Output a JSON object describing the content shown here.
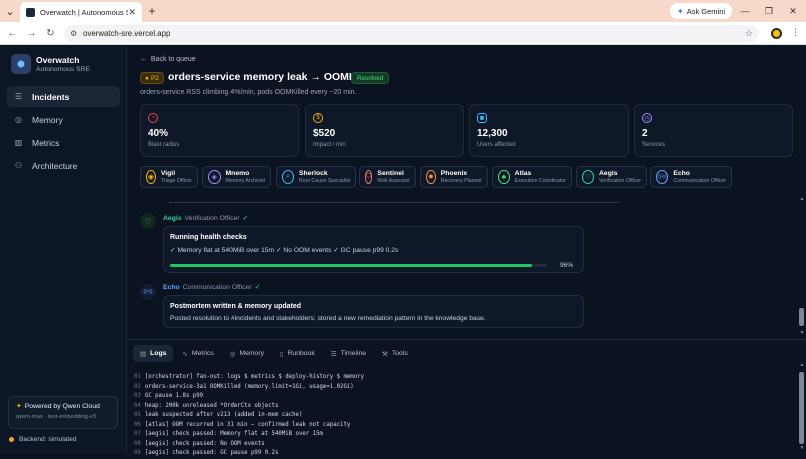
{
  "browser": {
    "tab_title": "Overwatch | Autonomous SRE",
    "tab_close": "✕",
    "new_tab": "+",
    "gemini_label": "Ask Gemini",
    "url": "overwatch-sre.vercel.app",
    "window_controls": [
      "—",
      "❐",
      "✕"
    ]
  },
  "sidebar": {
    "brand_name": "Overwatch",
    "brand_sub": "Autonomous SRE",
    "items": [
      {
        "label": "Incidents",
        "icon": "list-icon"
      },
      {
        "label": "Memory",
        "icon": "memory-icon"
      },
      {
        "label": "Metrics",
        "icon": "bar-chart-icon"
      },
      {
        "label": "Architecture",
        "icon": "tree-icon"
      }
    ],
    "powered_title": "Powered by Qwen Cloud",
    "powered_sub": "qwen-max · text-embedding-v3",
    "backend": "Backend: simulated"
  },
  "incident": {
    "back": "Back to queue",
    "priority": "P2",
    "title": "orders-service memory leak → OOMKilled",
    "status": "Resolved",
    "subtitle": "orders-service RSS climbing 4%/min, pods OOMKilled every ~20 min."
  },
  "stats": [
    {
      "value": "40%",
      "label": "Blast radius",
      "color": "#ef4444"
    },
    {
      "value": "$520",
      "label": "Impact / min",
      "color": "#f5b400"
    },
    {
      "value": "12,300",
      "label": "Users affected",
      "color": "#38bdf8"
    },
    {
      "value": "2",
      "label": "Services",
      "color": "#a78bfa"
    }
  ],
  "agents": [
    {
      "name": "Vigil",
      "role": "Triage Officer",
      "color": "#f5b400",
      "glyph": "◉"
    },
    {
      "name": "Mnemo",
      "role": "Memory Archivist",
      "color": "#a78bfa",
      "glyph": "◈"
    },
    {
      "name": "Sherlock",
      "role": "Root Cause Specialist",
      "color": "#38bdf8",
      "glyph": "⌕"
    },
    {
      "name": "Sentinel",
      "role": "Risk Assessor",
      "color": "#f87171",
      "glyph": "⛉"
    },
    {
      "name": "Phoenix",
      "role": "Recovery Planner",
      "color": "#fb923c",
      "glyph": "✹"
    },
    {
      "name": "Atlas",
      "role": "Execution Coordinator",
      "color": "#4ade80",
      "glyph": "♣"
    },
    {
      "name": "Aegis",
      "role": "Verification Officer",
      "color": "#34d399",
      "glyph": "♡"
    },
    {
      "name": "Echo",
      "role": "Communication Officer",
      "color": "#60a5fa",
      "glyph": "((•))"
    }
  ],
  "timeline": {
    "aegis": {
      "agent": "Aegis",
      "role": "Verification Officer",
      "card_title": "Running health checks",
      "card_body": "✓ Memory flat at 540MiB over 15m ✓ No OOM events ✓ GC pause p99 0.2s",
      "progress": 96,
      "progress_label": "96%"
    },
    "echo": {
      "agent": "Echo",
      "role": "Communication Officer",
      "card_title": "Postmortem written & memory updated",
      "card_body": "Posted resolution to #incidents and stakeholders; stored a new remediation pattern in the knowledge base."
    }
  },
  "console": {
    "tabs": [
      {
        "label": "Logs",
        "icon": "file-icon"
      },
      {
        "label": "Metrics",
        "icon": "pulse-icon"
      },
      {
        "label": "Memory",
        "icon": "memory-icon"
      },
      {
        "label": "Runbook",
        "icon": "book-icon"
      },
      {
        "label": "Timeline",
        "icon": "list-icon"
      },
      {
        "label": "Tools",
        "icon": "wrench-icon"
      }
    ],
    "logs": [
      {
        "n": "01",
        "text": "[orchestrator] fan-out: logs $ metrics $ deploy-history $ memory"
      },
      {
        "n": "02",
        "text": "orders-service-3a1 OOMKilled (memory.limit=1Gi, usage=1.02Gi)"
      },
      {
        "n": "03",
        "text": "GC pause 1.8s p99"
      },
      {
        "n": "04",
        "text": "heap: 200k unreleased *OrderCtx objects"
      },
      {
        "n": "05",
        "text": "leak suspected after v213 (added in-mem cache)"
      },
      {
        "n": "06",
        "text": "[atlas] OOM recurred in 31 min — confirmed leak not capacity"
      },
      {
        "n": "07",
        "text": "[aegis] check passed: Memory flat at 540MiB over 15m"
      },
      {
        "n": "08",
        "text": "[aegis] check passed: No OOM events"
      },
      {
        "n": "09",
        "text": "[aegis] check passed: GC pause p99 0.2s"
      }
    ]
  }
}
